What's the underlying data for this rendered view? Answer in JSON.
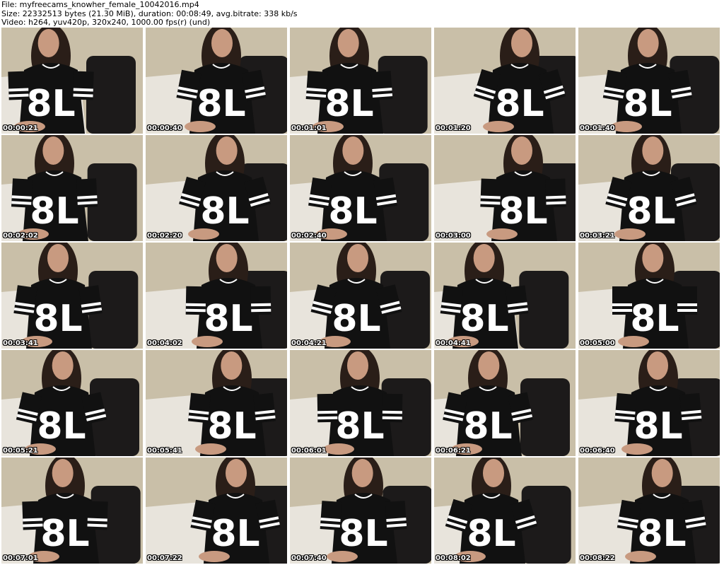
{
  "header": {
    "file_line": "File: myfreecams_knowher_female_10042016.mp4",
    "size_line": "Size: 22332513 bytes (21.30 MiB), duration: 00:08:49, avg.bitrate: 338 kb/s",
    "video_line": "Video: h264, yuv420p, 320x240, 1000.00 fps(r) (und)"
  },
  "jersey_text": "8L",
  "thumbnails": [
    {
      "timestamp": "00:00:21"
    },
    {
      "timestamp": "00:00:40"
    },
    {
      "timestamp": "00:01:01"
    },
    {
      "timestamp": "00:01:20"
    },
    {
      "timestamp": "00:01:40"
    },
    {
      "timestamp": "00:02:02"
    },
    {
      "timestamp": "00:02:20"
    },
    {
      "timestamp": "00:02:40"
    },
    {
      "timestamp": "00:03:00"
    },
    {
      "timestamp": "00:03:21"
    },
    {
      "timestamp": "00:03:41"
    },
    {
      "timestamp": "00:04:02"
    },
    {
      "timestamp": "00:04:21"
    },
    {
      "timestamp": "00:04:41"
    },
    {
      "timestamp": "00:05:00"
    },
    {
      "timestamp": "00:05:21"
    },
    {
      "timestamp": "00:05:41"
    },
    {
      "timestamp": "00:06:01"
    },
    {
      "timestamp": "00:06:21"
    },
    {
      "timestamp": "00:06:40"
    },
    {
      "timestamp": "00:07:01"
    },
    {
      "timestamp": "00:07:22"
    },
    {
      "timestamp": "00:07:40"
    },
    {
      "timestamp": "00:08:02"
    },
    {
      "timestamp": "00:08:22"
    }
  ],
  "colors": {
    "wall": "#c9bfa8",
    "bed": "#e8e4dc",
    "chair": "#1c1a1a",
    "jersey": "#111111",
    "skin": "#c89a80",
    "hair": "#2a1e18"
  }
}
